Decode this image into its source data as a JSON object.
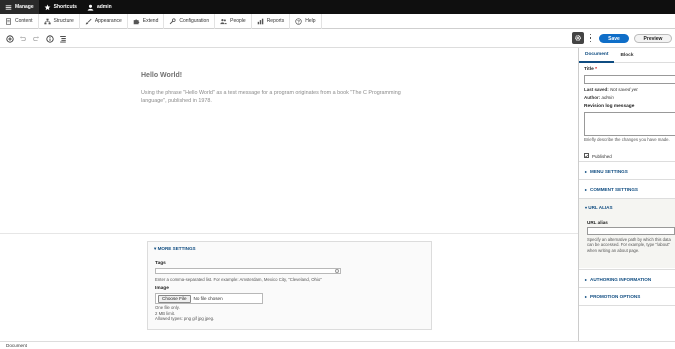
{
  "toolbar_top": {
    "manage": "Manage",
    "shortcuts": "Shortcuts",
    "user": "admin"
  },
  "admin_menu": {
    "items": [
      "Content",
      "Structure",
      "Appearance",
      "Extend",
      "Configuration",
      "People",
      "Reports",
      "Help"
    ]
  },
  "editor_toolbar": {
    "save": "Save",
    "preview": "Preview"
  },
  "canvas": {
    "title": "Hello World!",
    "paragraph": "Using the phrase \"Hello World\" as a test message for a program originates from a book \"The C Programming language\", published in 1978."
  },
  "more_settings": {
    "heading": "▾ MORE SETTINGS",
    "tags_label": "Tags",
    "tags_value": "",
    "tags_description": "Enter a comma-separated list. For example: Amsterdam, Mexico City, \"Cleveland, Ohio\"",
    "image_label": "Image",
    "file_button": "Choose File",
    "file_status": "No file chosen",
    "file_rules": [
      "One file only.",
      "2 MB limit.",
      "Allowed types: png gif jpg jpeg."
    ]
  },
  "sidebar": {
    "tabs": [
      "Document",
      "Block"
    ],
    "active_tab": "Document",
    "title_label": "Title",
    "required_mark": "*",
    "last_saved_label": "Last saved:",
    "last_saved_value": "Not saved yet",
    "author_label": "Author:",
    "author_value": "admin",
    "revision_label": "Revision log message",
    "revision_value": "",
    "revision_help": "Briefly describe the changes you have made.",
    "published_label": "Published",
    "published_checked": true,
    "panels": {
      "menu": "MENU SETTINGS",
      "comment": "COMMENT SETTINGS",
      "alias": "URL ALIAS",
      "authoring": "AUTHORING INFORMATION",
      "promotion": "PROMOTION OPTIONS"
    },
    "alias_label": "URL alias",
    "alias_value": "",
    "alias_help": "Specify an alternative path by which this data can be accessed. For example, type \"/about\" when writing an about page."
  },
  "status_bar": {
    "text": "Document"
  },
  "colors": {
    "accent": "#0f6ec8",
    "link": "#0f4c81",
    "toolbar_bg": "#0f0f0f"
  }
}
